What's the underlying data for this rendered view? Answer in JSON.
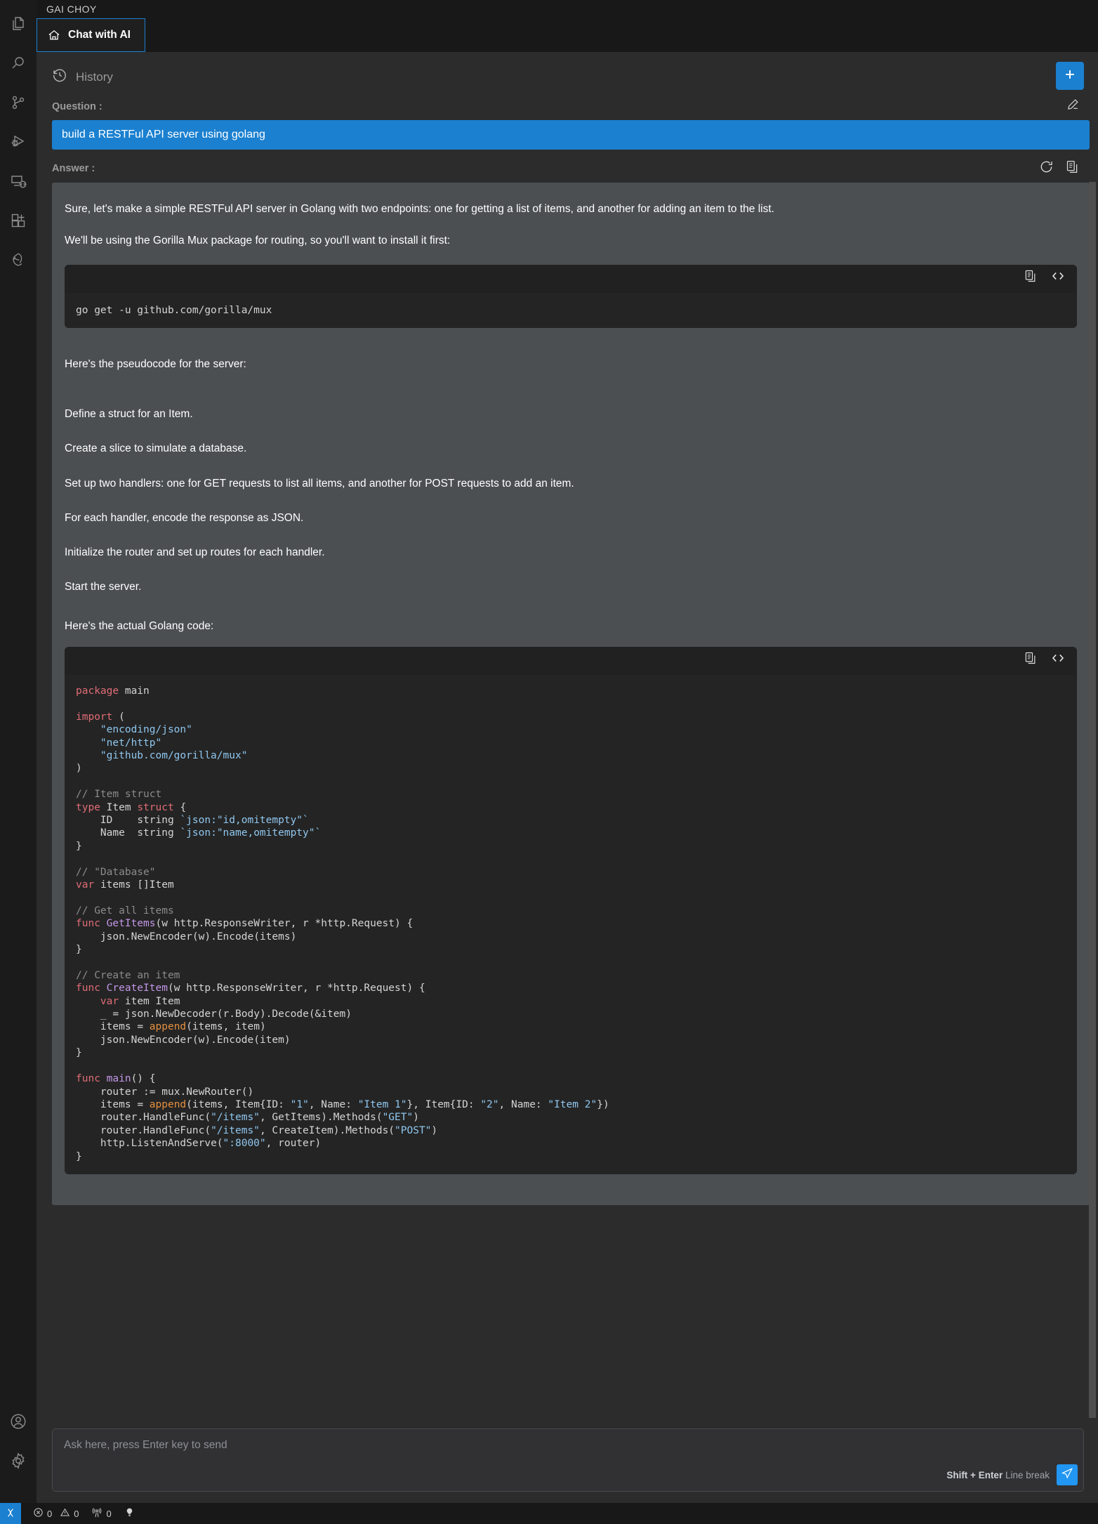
{
  "window": {
    "title": "GAI CHOY"
  },
  "activity_bar": {
    "items": [
      {
        "name": "explorer-icon",
        "label": "Explorer"
      },
      {
        "name": "search-icon",
        "label": "Search"
      },
      {
        "name": "source-control-icon",
        "label": "Source Control"
      },
      {
        "name": "run-and-debug-icon",
        "label": "Run and Debug"
      },
      {
        "name": "remote-explorer-icon",
        "label": "Remote Explorer"
      },
      {
        "name": "extensions-icon",
        "label": "Extensions"
      },
      {
        "name": "gai-choy-icon",
        "label": "GAI CHOY"
      }
    ],
    "bottom_items": [
      {
        "name": "accounts-icon",
        "label": "Accounts"
      },
      {
        "name": "manage-settings-icon",
        "label": "Manage"
      }
    ]
  },
  "tab": {
    "label": "Chat with AI",
    "icon": "home-icon"
  },
  "toolbar": {
    "history_label": "History",
    "history_icon": "history-icon",
    "new_chat_icon": "plus-icon"
  },
  "question": {
    "label": "Question :",
    "text": "build a RESTFul API server using golang",
    "edit_icon": "pencil-icon"
  },
  "answer": {
    "label": "Answer :",
    "refresh_icon": "refresh-icon",
    "copy_icon": "copy-icon",
    "paragraphs": [
      "Sure, let's make a simple RESTFul API server in Golang with two endpoints: one for getting a list of items, and another for adding an item to the list.",
      "We'll be using the Gorilla Mux package for routing, so you'll want to install it first:"
    ],
    "pseudocode_intro": "Here's the pseudocode for the server:",
    "pseudocode_steps": [
      "Define a struct for an Item.",
      "Create a slice to simulate a database.",
      "Set up two handlers: one for GET requests to list all items, and another for POST requests to add an item.",
      "For each handler, encode the response as JSON.",
      "Initialize the router and set up routes for each handler.",
      "Start the server."
    ],
    "code_intro": "Here's the actual Golang code:"
  },
  "code_blocks": [
    {
      "id": "install-command",
      "copy_icon": "copy-icon",
      "code_icon": "code-brackets-icon",
      "language": "shell",
      "text": "go get -u github.com/gorilla/mux"
    },
    {
      "id": "golang-server",
      "copy_icon": "copy-icon",
      "code_icon": "code-brackets-icon",
      "language": "go",
      "text": "package main\n\nimport (\n    \"encoding/json\"\n    \"net/http\"\n    \"github.com/gorilla/mux\"\n)\n\n// Item struct\ntype Item struct {\n    ID    string `json:\"id,omitempty\"`\n    Name  string `json:\"name,omitempty\"`\n}\n\n// \"Database\"\nvar items []Item\n\n// Get all items\nfunc GetItems(w http.ResponseWriter, r *http.Request) {\n    json.NewEncoder(w).Encode(items)\n}\n\n// Create an item\nfunc CreateItem(w http.ResponseWriter, r *http.Request) {\n    var item Item\n    _ = json.NewDecoder(r.Body).Decode(&item)\n    items = append(items, item)\n    json.NewEncoder(w).Encode(item)\n}\n\nfunc main() {\n    router := mux.NewRouter()\n    items = append(items, Item{ID: \"1\", Name: \"Item 1\"}, Item{ID: \"2\", Name: \"Item 2\"})\n    router.HandleFunc(\"/items\", GetItems).Methods(\"GET\")\n    router.HandleFunc(\"/items\", CreateItem).Methods(\"POST\")\n    http.ListenAndServe(\":8000\", router)\n}"
    }
  ],
  "composer": {
    "placeholder": "Ask here, press Enter key to send",
    "hint_bold": "Shift + Enter",
    "hint_rest": " Line break",
    "send_icon": "send-icon"
  },
  "status_bar": {
    "remote_icon": "remote-window-icon",
    "errors_icon": "error-icon",
    "errors": "0",
    "warnings_icon": "warning-icon",
    "warnings": "0",
    "ports_icon": "radio-tower-icon",
    "ports": "0",
    "bell_icon": "lightbulb-icon"
  },
  "colors": {
    "accent": "#1b80d0",
    "send_button": "#2196f3",
    "answer_bg": "#4b4f52",
    "code_bg": "#242424",
    "panel_bg": "#2c2c2d"
  }
}
